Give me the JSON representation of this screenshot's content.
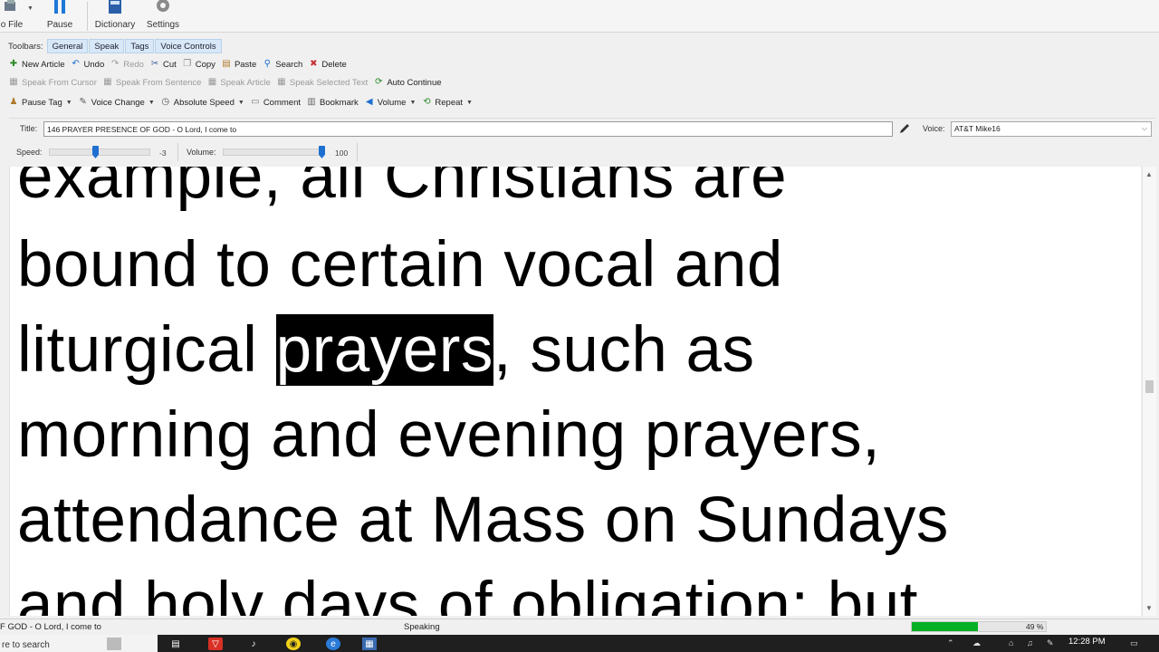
{
  "ribbon": {
    "file_label": "o File",
    "pause_label": "Pause",
    "dictionary_label": "Dictionary",
    "settings_label": "Settings"
  },
  "toolbars": {
    "label": "Toolbars:",
    "tabs": [
      "General",
      "Speak",
      "Tags",
      "Voice Controls"
    ],
    "row1": {
      "new_article": "New Article",
      "undo": "Undo",
      "redo": "Redo",
      "cut": "Cut",
      "copy": "Copy",
      "paste": "Paste",
      "search": "Search",
      "delete": "Delete"
    },
    "row2": {
      "speak_from_cursor": "Speak From Cursor",
      "speak_from_sentence": "Speak From Sentence",
      "speak_article": "Speak Article",
      "speak_selected_text": "Speak Selected Text",
      "auto_continue": "Auto Continue"
    },
    "row3": {
      "pause_tag": "Pause Tag",
      "voice_change": "Voice Change",
      "absolute_speed": "Absolute Speed",
      "comment": "Comment",
      "bookmark": "Bookmark",
      "volume": "Volume",
      "repeat": "Repeat"
    }
  },
  "title_bar": {
    "title_label": "Title:",
    "title_value": "146 PRAYER PRESENCE OF GOD - O Lord, I come to",
    "voice_label": "Voice:",
    "voice_value": "AT&T Mike16"
  },
  "sliders": {
    "speed_label": "Speed:",
    "speed_value": "-3",
    "speed_fraction": 0.45,
    "volume_label": "Volume:",
    "volume_value": "100",
    "volume_fraction": 1.0
  },
  "document": {
    "lines": [
      {
        "before": "example, all Christians are",
        "highlight": "",
        "after": ""
      },
      {
        "before": "bound to certain vocal and",
        "highlight": "",
        "after": ""
      },
      {
        "before": "liturgical ",
        "highlight": "prayers",
        "after": ", such as"
      },
      {
        "before": "morning and evening prayers,",
        "highlight": "",
        "after": ""
      },
      {
        "before": "attendance at Mass on Sundays",
        "highlight": "",
        "after": ""
      },
      {
        "before": "and holy days of obligation; but",
        "highlight": "",
        "after": ""
      }
    ]
  },
  "status_bar": {
    "article_text": "F GOD - O Lord, I come to",
    "state": "Speaking",
    "progress_text": "49 %",
    "progress_fraction": 0.49
  },
  "taskbar": {
    "search_placeholder": "re to search",
    "clock": "12:28 PM"
  },
  "colors": {
    "progress_fill": "#06b025",
    "slider_thumb": "#1e6fd0",
    "tab_background": "#d8e8f8",
    "highlight_background": "#000000"
  }
}
